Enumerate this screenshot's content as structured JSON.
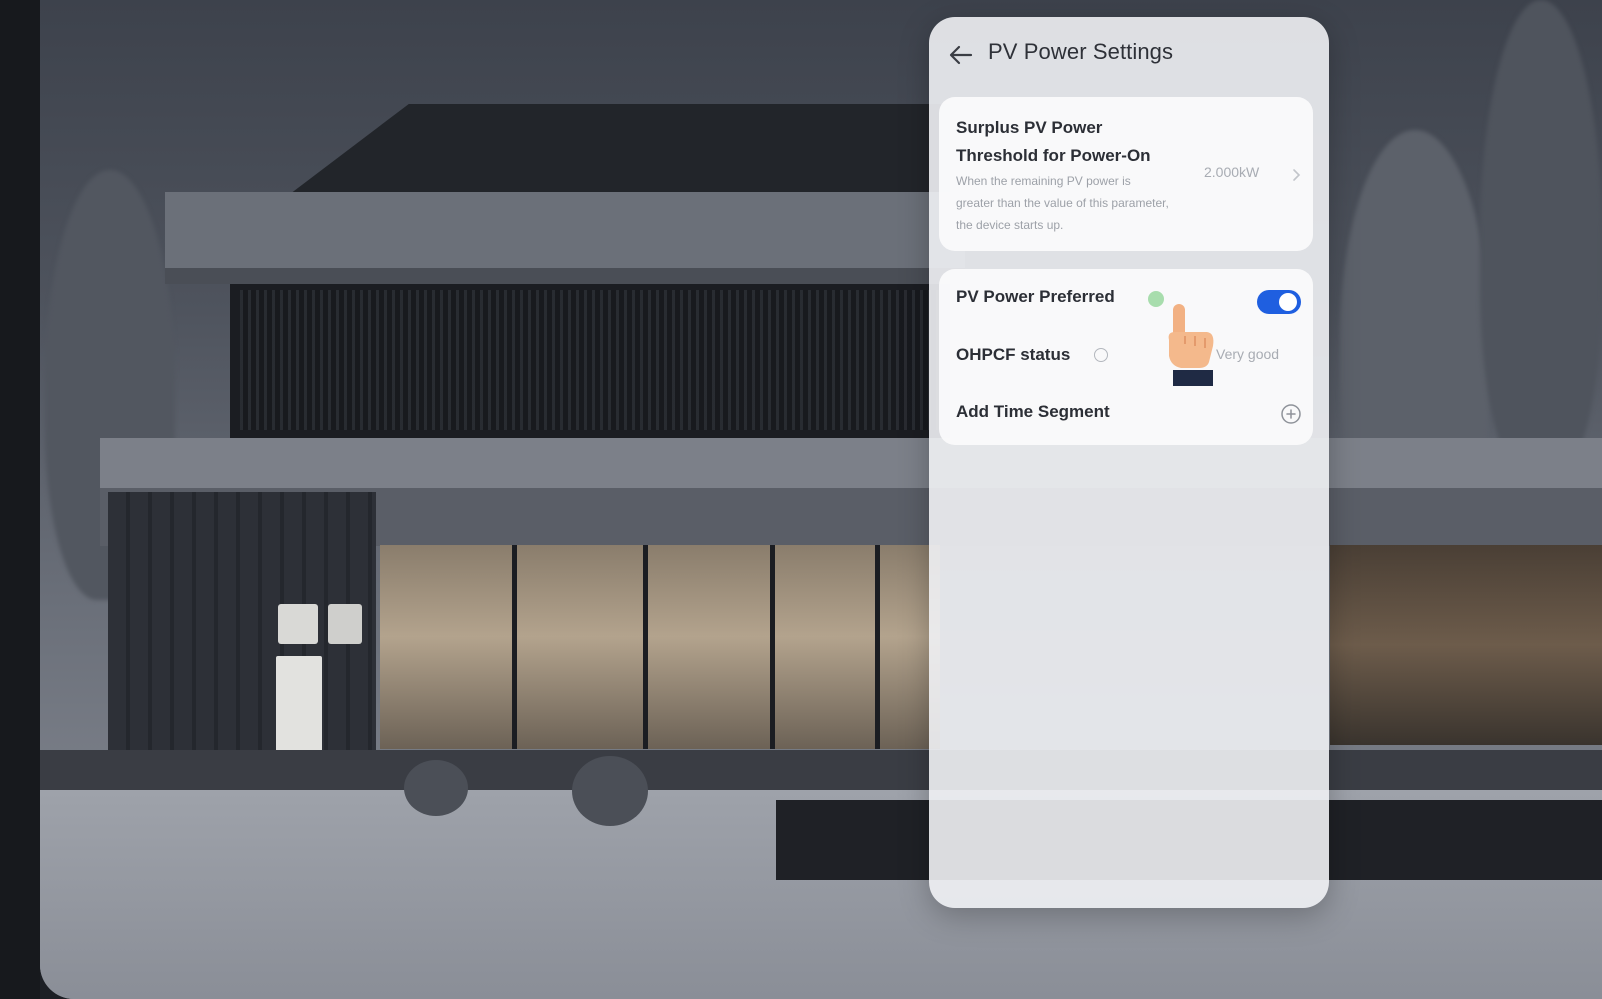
{
  "panel": {
    "title": "PV Power Settings",
    "back_icon": "arrow-left-icon"
  },
  "threshold": {
    "title": "Surplus PV Power Threshold for Power-On",
    "description": "When the remaining PV power is greater than the value of this parameter, the device starts up.",
    "value": "2.000kW",
    "chevron_icon": "chevron-right-icon"
  },
  "settings": {
    "pv_power_preferred": {
      "label": "PV Power Preferred",
      "enabled": true,
      "info_icon": "info-icon"
    },
    "ohpcf_status": {
      "label": "OHPCF status",
      "value": "Very good",
      "info_icon": "info-icon"
    },
    "add_time_segment": {
      "label": "Add Time Segment",
      "icon": "plus-circle-icon"
    }
  },
  "colors": {
    "accent": "#1f5fe0",
    "panel_bg": "#f0f1f4",
    "text_primary": "#2c2f36",
    "text_secondary": "#a8acb3"
  }
}
